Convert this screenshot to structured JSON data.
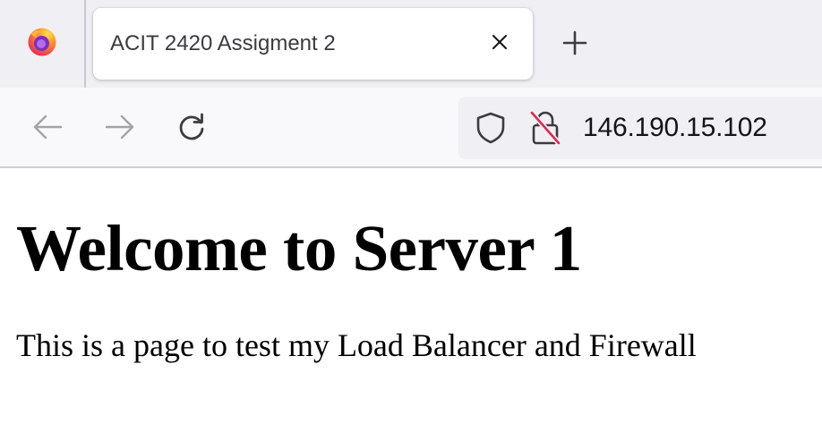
{
  "browser": {
    "tab": {
      "title": "ACIT 2420 Assigment 2"
    },
    "address_bar": {
      "url": "146.190.15.102"
    },
    "icons": {
      "app": "firefox-icon",
      "close": "close-icon",
      "new_tab": "plus-icon",
      "back": "back-arrow-icon",
      "forward": "forward-arrow-icon",
      "reload": "reload-icon",
      "tracking": "shield-icon",
      "insecure": "insecure-lock-icon"
    },
    "colors": {
      "insecure_slash": "#e22850",
      "tab_strip": "#f0f0f4",
      "toolbar": "#f9f9fb"
    }
  },
  "page": {
    "heading": "Welcome to Server 1",
    "body": "This is a page to test my Load Balancer and Firewall"
  }
}
